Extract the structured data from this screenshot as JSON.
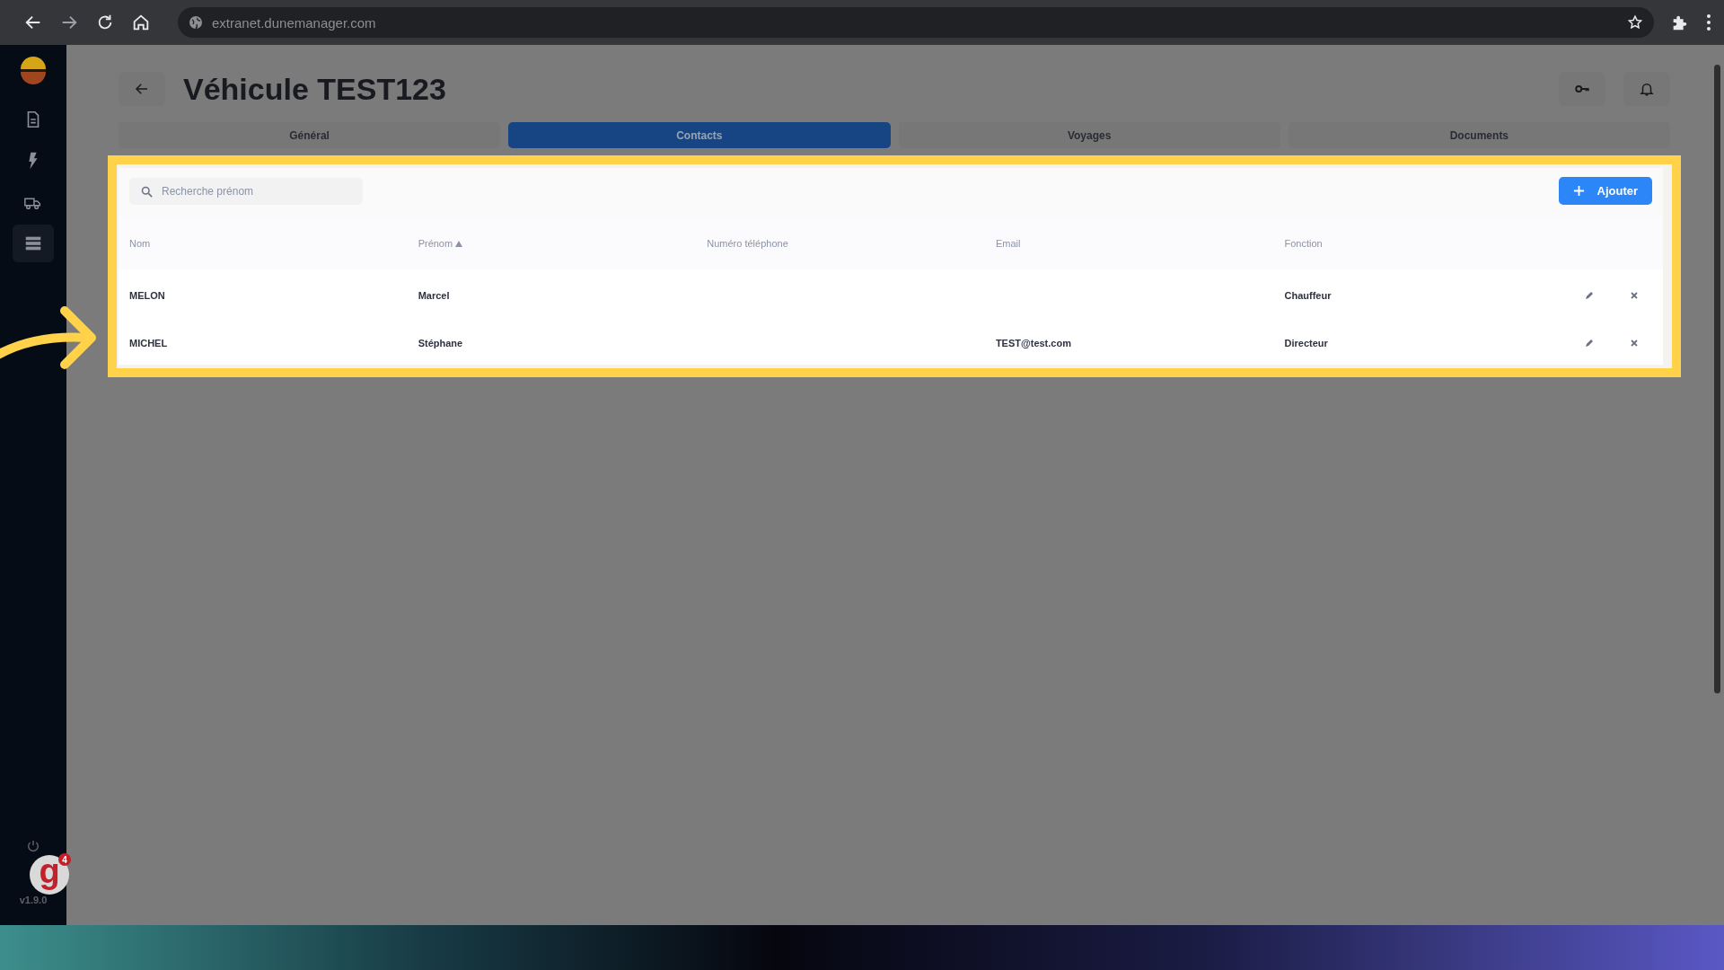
{
  "browser": {
    "url": "extranet.dunemanager.com"
  },
  "sidebar": {
    "items": [
      {
        "kind": "document",
        "selected": false
      },
      {
        "kind": "bolt",
        "selected": false
      },
      {
        "kind": "truck",
        "selected": false
      },
      {
        "kind": "list",
        "selected": true
      }
    ],
    "version": "v1.9.0"
  },
  "overlay_badge": {
    "letter": "g",
    "count": "4"
  },
  "page": {
    "title": "Véhicule TEST123"
  },
  "tabs": [
    {
      "label": "Général",
      "selected": false
    },
    {
      "label": "Contacts",
      "selected": true
    },
    {
      "label": "Voyages",
      "selected": false
    },
    {
      "label": "Documents",
      "selected": false
    }
  ],
  "search": {
    "placeholder": "Recherche prénom"
  },
  "add_button": {
    "label": "Ajouter"
  },
  "table": {
    "columns": [
      {
        "label": "Nom",
        "sorted": false
      },
      {
        "label": "Prénom",
        "sorted": true
      },
      {
        "label": "Numéro téléphone",
        "sorted": false
      },
      {
        "label": "Email",
        "sorted": false
      },
      {
        "label": "Fonction",
        "sorted": false
      }
    ],
    "rows": [
      [
        "MELON",
        "Marcel",
        "",
        "",
        "Chauffeur"
      ],
      [
        "MICHEL",
        "Stéphane",
        "",
        "TEST@test.com",
        "Directeur"
      ]
    ]
  }
}
